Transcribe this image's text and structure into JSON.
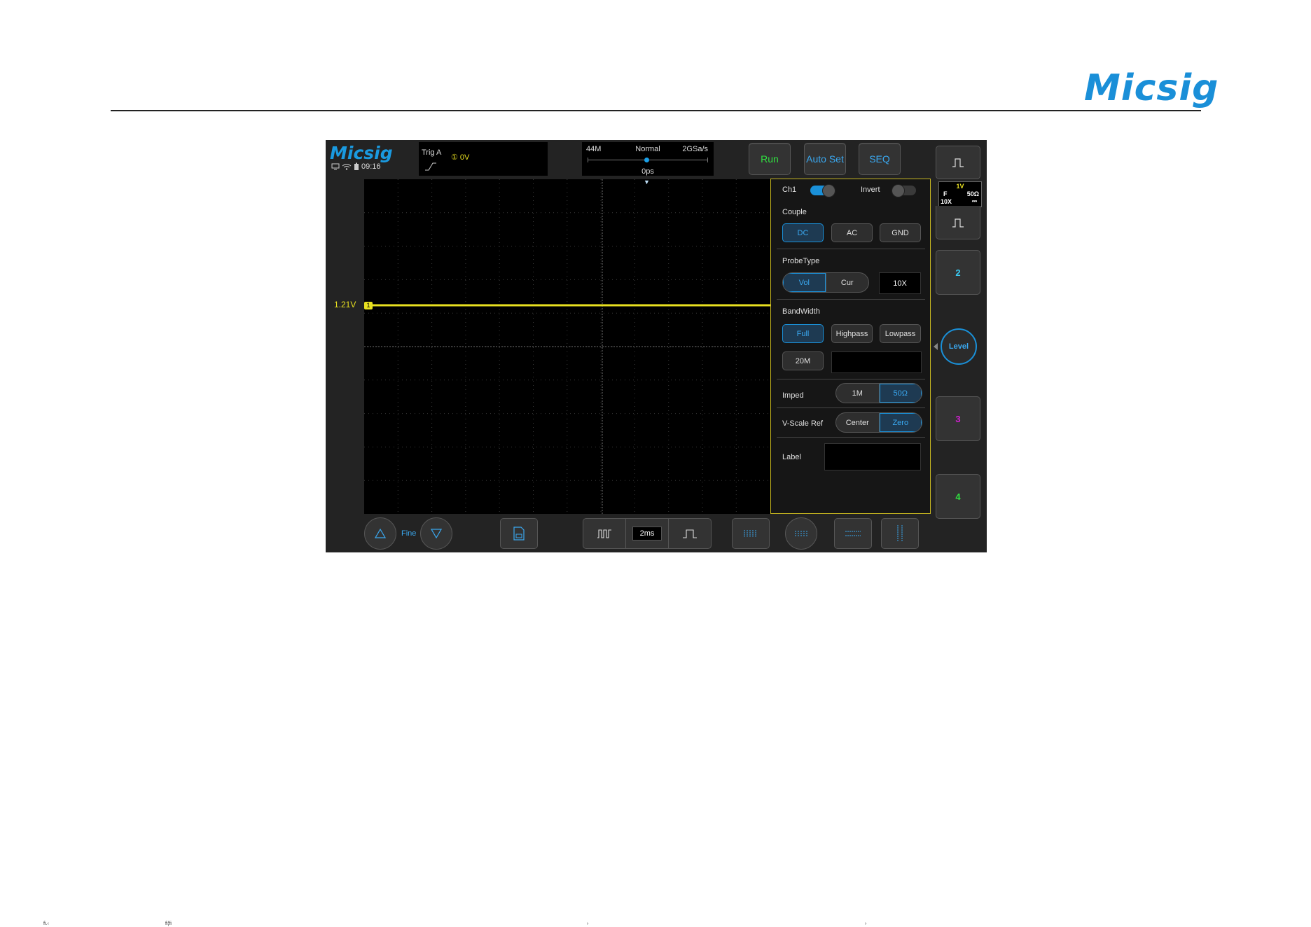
{
  "page": {
    "brand": "Micsig",
    "footer_fragments": [
      "ﬁ.‹",
      "ﬁ¦ﬁ",
      "›",
      "›"
    ]
  },
  "scope": {
    "logo": "Micsig",
    "clock": "09:16",
    "trigger": {
      "label": "Trig  A",
      "level": "① 0V"
    },
    "timebase": {
      "memory": "44M",
      "mode": "Normal",
      "sample_rate": "2GSa/s",
      "position": "0ps",
      "position_fraction": 0.5
    },
    "buttons": {
      "run": "Run",
      "autoset": "Auto Set",
      "seq": "SEQ"
    },
    "channel": {
      "level_label": "1.21V",
      "marker": "1"
    },
    "panel": {
      "ch1_label": "Ch1",
      "ch1_on": true,
      "invert_label": "Invert",
      "invert_on": false,
      "couple_label": "Couple",
      "couple_options": [
        "DC",
        "AC",
        "GND"
      ],
      "couple_selected": "DC",
      "probetype_label": "ProbeType",
      "probetype_options": [
        "Vol",
        "Cur"
      ],
      "probetype_selected": "Vol",
      "probe_ratio": "10X",
      "bandwidth_label": "BandWidth",
      "bandwidth_options": [
        "Full",
        "Highpass",
        "Lowpass"
      ],
      "bandwidth_selected": "Full",
      "bw_limit": "20M",
      "imped_label": "Imped",
      "imped_options": [
        "1M",
        "50Ω"
      ],
      "imped_selected": "50Ω",
      "vscale_label": "V-Scale Ref",
      "vscale_options": [
        "Center",
        "Zero"
      ],
      "vscale_selected": "Zero",
      "label_label": "Label"
    },
    "side": {
      "ch1_scale": "1V",
      "ch1_bw": "F",
      "ch1_imped": "50Ω",
      "ch1_probe": "10X",
      "ch1_coupling": "⎓",
      "ch2": "2",
      "level": "Level",
      "ch3": "3",
      "ch4": "4"
    },
    "bottom": {
      "fine": "Fine",
      "timebase": "2ms"
    },
    "colors": {
      "ch1": "#e8e020",
      "ch2": "#3ac8f0",
      "ch3": "#d020d0",
      "ch4": "#30e040",
      "accent": "#1a90d8",
      "run": "#30e040"
    }
  }
}
